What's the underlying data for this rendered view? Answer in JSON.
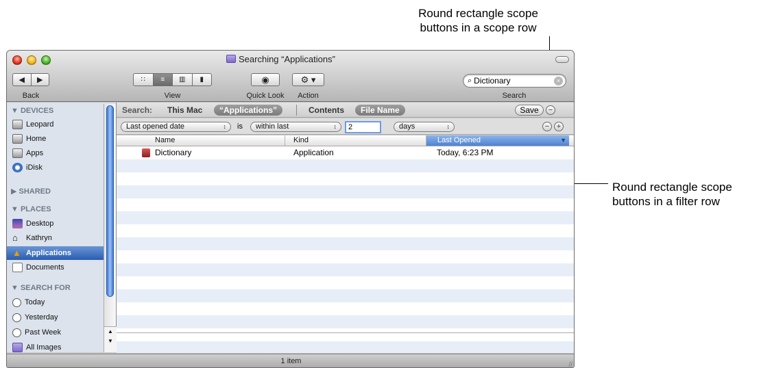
{
  "callouts": {
    "top_line1": "Round rectangle scope",
    "top_line2": "buttons in a scope row",
    "right_line1": "Round rectangle scope",
    "right_line2": "buttons in a filter row"
  },
  "window": {
    "title": "Searching “Applications”"
  },
  "toolbar": {
    "back_label": "Back",
    "back_glyph": "◀",
    "forward_glyph": "▶",
    "view_label": "View",
    "view_icons": [
      "∷",
      "≡",
      "▥",
      "▮"
    ],
    "quicklook_label": "Quick Look",
    "quicklook_glyph": "◉",
    "action_label": "Action",
    "action_glyph": "⚙ ▾",
    "search_label": "Search",
    "search_value": "Dictionary",
    "search_glyph": "⌕",
    "clear_glyph": "×"
  },
  "sidebar": {
    "devices_header": "▼ DEVICES",
    "devices": [
      "Leopard",
      "Home",
      "Apps",
      "iDisk"
    ],
    "shared_header": "▶ SHARED",
    "places_header": "▼ PLACES",
    "places": [
      "Desktop",
      "Kathryn",
      "Applications",
      "Documents"
    ],
    "search_header": "▼ SEARCH FOR",
    "searches": [
      "Today",
      "Yesterday",
      "Past Week",
      "All Images"
    ],
    "selected": "Applications",
    "scroll_up": "▲",
    "scroll_down": "▼"
  },
  "scope_row": {
    "search_label": "Search:",
    "this_mac": "This Mac",
    "applications": "“Applications”",
    "contents": "Contents",
    "file_name": "File Name",
    "save": "Save",
    "remove": "−"
  },
  "filter_row": {
    "attribute": "Last opened date",
    "operator_label": "is",
    "operator": "within last",
    "value": "2",
    "unit": "days",
    "popup_arrow": "↕",
    "remove": "−",
    "add": "+"
  },
  "table": {
    "columns": [
      "Name",
      "Kind",
      "Last Opened"
    ],
    "sort_glyph": "▼",
    "rows": [
      {
        "name": "Dictionary",
        "kind": "Application",
        "last_opened": "Today, 6:23 PM"
      }
    ]
  },
  "status": {
    "text": "1 item",
    "grip": "//"
  }
}
